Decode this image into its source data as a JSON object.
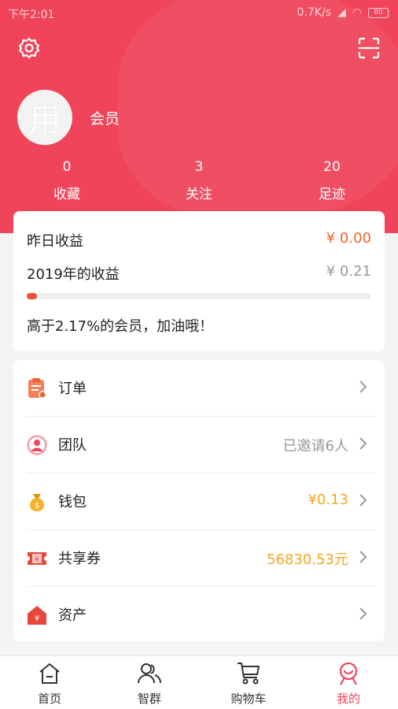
{
  "statusbar": {
    "time": "下午2:01",
    "speed": "0.7K/s",
    "battery": "80"
  },
  "profile": {
    "avatar_char": "用",
    "name": "会员"
  },
  "stats": [
    {
      "num": "0",
      "label": "收藏"
    },
    {
      "num": "3",
      "label": "关注"
    },
    {
      "num": "20",
      "label": "足迹"
    }
  ],
  "earnings": {
    "yesterday_label": "昨日收益",
    "yesterday_value": "¥ 0.00",
    "year_label": "2019年的收益",
    "year_value": "¥ 0.21",
    "progress": 0.03,
    "note": "高于2.17%的会员，加油哦！"
  },
  "menu": [
    {
      "label": "订单",
      "value": ""
    },
    {
      "label": "团队",
      "value": "已邀请6人"
    },
    {
      "label": "钱包",
      "value": "¥0.13"
    },
    {
      "label": "共享券",
      "value": "56830.53元"
    },
    {
      "label": "资产",
      "value": ""
    }
  ],
  "tabs": [
    {
      "label": "首页"
    },
    {
      "label": "智群"
    },
    {
      "label": "购物车"
    },
    {
      "label": "我的"
    }
  ],
  "colors": {
    "brand": "#f0445a",
    "accent_orange": "#f0622b",
    "accent_yellow": "#f3a823"
  }
}
